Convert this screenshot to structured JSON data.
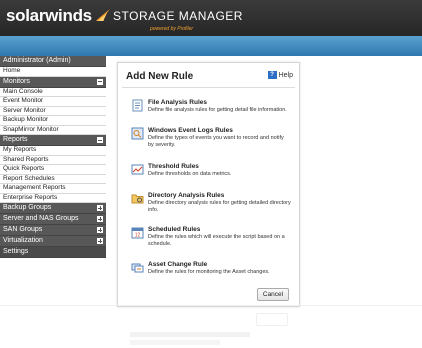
{
  "header": {
    "brand": "solarwinds",
    "product": "STORAGE MANAGER",
    "powered_by": "powered by Profiler"
  },
  "sidebar": {
    "user": "Administrator (Admin)",
    "home": "Home",
    "monitors": {
      "label": "Monitors",
      "items": [
        "Main Console",
        "Event Monitor",
        "Server Monitor",
        "Backup Monitor",
        "SnapMirror Monitor"
      ]
    },
    "reports": {
      "label": "Reports",
      "items": [
        "My Reports",
        "Shared Reports",
        "Quick Reports",
        "Report Schedules",
        "Management Reports",
        "Enterprise Reports"
      ]
    },
    "groups": [
      "Backup Groups",
      "Server and NAS Groups",
      "SAN Groups",
      "Virtualization"
    ],
    "settings": "Settings"
  },
  "panel": {
    "title": "Add New Rule",
    "help": "Help",
    "rules": [
      {
        "name": "File Analysis Rules",
        "desc": "Define file analysis rules for getting detail file information.",
        "icon": "file-analysis-icon"
      },
      {
        "name": "Windows Event Logs Rules",
        "desc": "Define the types of events you want to record and notify by severity.",
        "icon": "event-log-icon"
      },
      {
        "name": "Threshold Rules",
        "desc": "Define thresholds on data metrics.",
        "icon": "threshold-icon"
      },
      {
        "name": "Directory Analysis Rules",
        "desc": "Define directory analysis rules for getting detailed directory info.",
        "icon": "directory-icon"
      },
      {
        "name": "Scheduled Rules",
        "desc": "Define the rules which will execute the script based on a schedule.",
        "icon": "calendar-icon"
      },
      {
        "name": "Asset Change Rule",
        "desc": "Define the rules for monitoring the Asset changes.",
        "icon": "asset-change-icon"
      }
    ],
    "cancel": "Cancel"
  },
  "colors": {
    "topbar": "#2e2e2e",
    "bluebar": "#3f8cc4",
    "sidebar_header": "#585858",
    "accent": "#f0a030"
  }
}
